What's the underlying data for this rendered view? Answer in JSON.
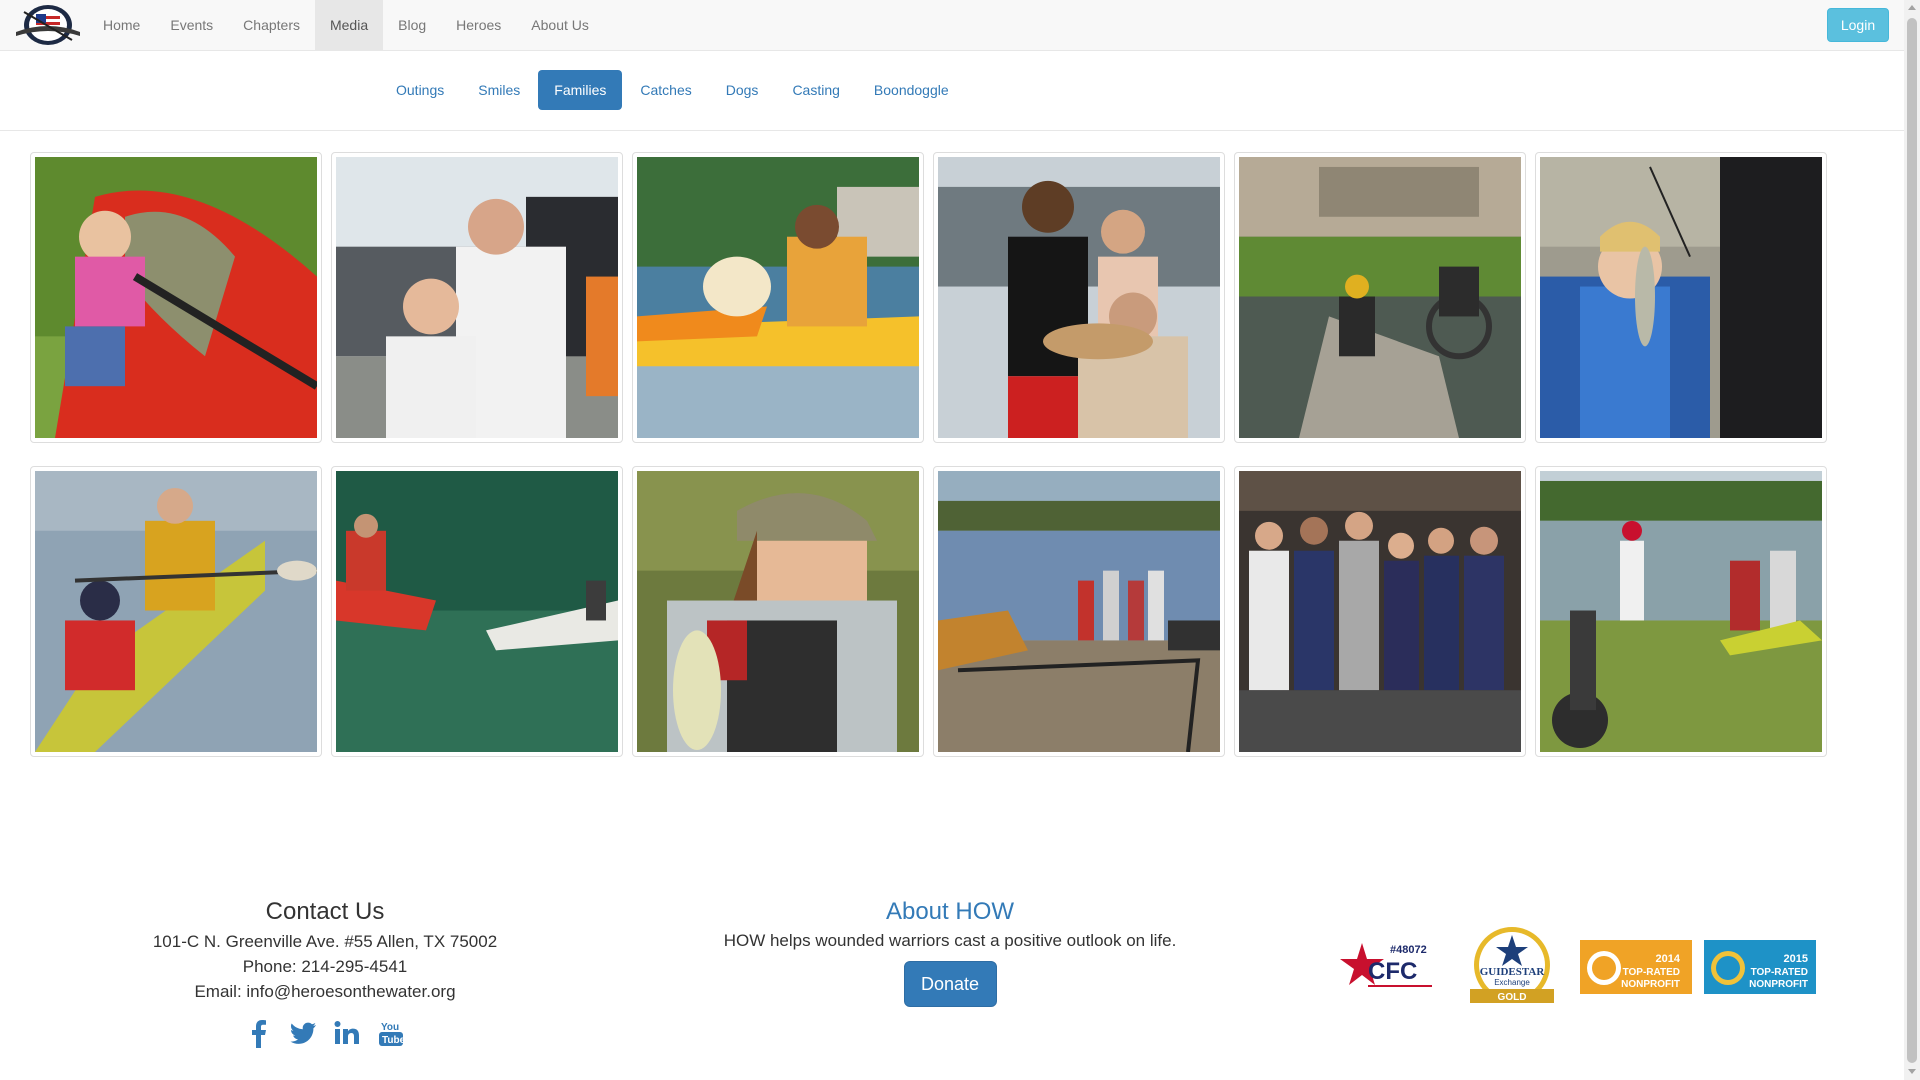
{
  "nav": {
    "logo_alt": "HEROES ON THE WATER",
    "items": [
      "Home",
      "Events",
      "Chapters",
      "Media",
      "Blog",
      "Heroes",
      "About Us"
    ],
    "active": "Media",
    "login_label": "Login"
  },
  "subnav": {
    "items": [
      "Outings",
      "Smiles",
      "Families",
      "Catches",
      "Dogs",
      "Casting",
      "Boondoggle"
    ],
    "active": "Families"
  },
  "gallery": {
    "photos": [
      {
        "subject": "child-in-red-kayak"
      },
      {
        "subject": "man-and-boy-by-trailer"
      },
      {
        "subject": "dog-and-man-in-yellow-kayak"
      },
      {
        "subject": "family-holding-fish"
      },
      {
        "subject": "fishing-by-river-bridge"
      },
      {
        "subject": "boy-holding-fish"
      },
      {
        "subject": "adult-and-child-kayaking"
      },
      {
        "subject": "kayakers-on-green-water"
      },
      {
        "subject": "kid-with-fish-in-camo-cap"
      },
      {
        "subject": "group-at-lake-shore"
      },
      {
        "subject": "group-photo-indoors"
      },
      {
        "subject": "family-at-pond"
      }
    ]
  },
  "footer": {
    "contact": {
      "title": "Contact Us",
      "address": "101-C N. Greenville Ave. #55 Allen, TX 75002",
      "phone": "Phone: 214-295-4541",
      "email": "Email: info@heroesonthewater.org"
    },
    "social": [
      "facebook-icon",
      "twitter-icon",
      "linkedin-icon",
      "youtube-icon"
    ],
    "about": {
      "title": "About HOW",
      "text": "HOW helps wounded warriors cast a positive outlook on life.",
      "donate_label": "Donate"
    },
    "badges": {
      "cfc_number": "#48072",
      "cfc_label": "CFC",
      "guidestar_line1": "GUIDESTAR",
      "guidestar_line2": "Exchange",
      "guidestar_line3": "GOLD",
      "gnp_2014_year": "2014",
      "gnp_2014_line1": "TOP-RATED",
      "gnp_2014_line2": "NONPROFIT",
      "gnp_2015_year": "2015",
      "gnp_2015_line1": "TOP-RATED",
      "gnp_2015_line2": "NONPROFIT"
    }
  },
  "colors": {
    "brand_blue": "#337ab7",
    "login_cyan": "#5bc0de",
    "nav_bg": "#f8f8f8"
  }
}
